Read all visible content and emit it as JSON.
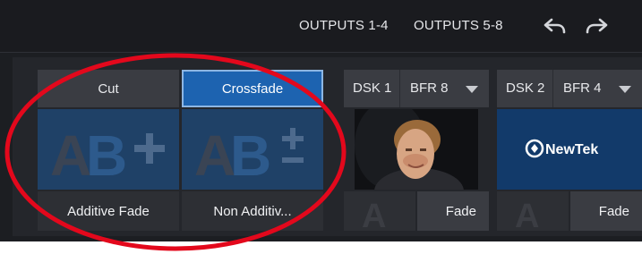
{
  "tabs": {
    "outputs_1_4": "OUTPUTS 1-4",
    "outputs_5_8": "OUTPUTS 5-8"
  },
  "transition": {
    "cut_label": "Cut",
    "crossfade_label": "Crossfade",
    "additive_label": "Additive Fade",
    "non_additive_label": "Non Additiv..."
  },
  "dsk1": {
    "name": "DSK 1",
    "buffer": "BFR 8",
    "fade_label": "Fade"
  },
  "dsk2": {
    "name": "DSK 2",
    "buffer": "BFR 4",
    "fade_label": "Fade",
    "logo_text": "NewTek"
  },
  "colors": {
    "accent": "#1d63b0",
    "annotation": "#e3081c",
    "tile_blue": "#1f4167"
  }
}
